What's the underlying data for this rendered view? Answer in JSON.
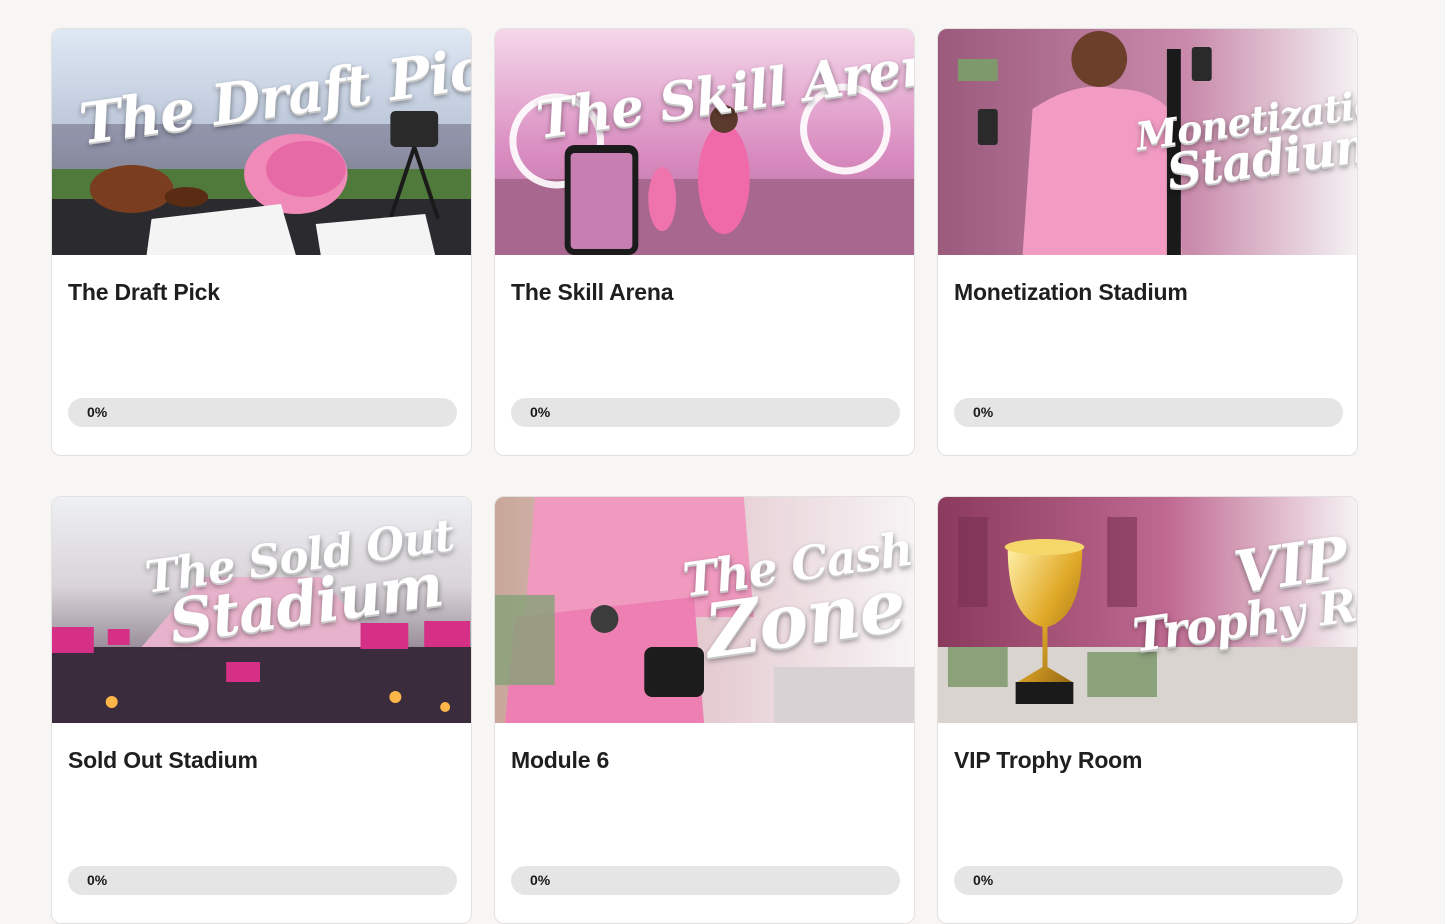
{
  "courses": [
    {
      "title": "The Draft Pick",
      "progress_label": "0%",
      "progress": 0,
      "thumbnail": {
        "line1": "The Draft Pick",
        "line2": "",
        "icon": "pink-helmet-stadium-image"
      }
    },
    {
      "title": "The Skill Arena",
      "progress_label": "0%",
      "progress": 0,
      "thumbnail": {
        "line1": "The Skill Arena",
        "line2": "",
        "icon": "pink-soccer-player-image"
      }
    },
    {
      "title": "Monetization Stadium",
      "progress_label": "0%",
      "progress": 0,
      "thumbnail": {
        "line1": "Monetization",
        "line2": "Stadium",
        "icon": "pink-jersey-media-image"
      }
    },
    {
      "title": "Sold Out Stadium",
      "progress_label": "0%",
      "progress": 0,
      "thumbnail": {
        "line1": "The Sold Out",
        "line2": "Stadium",
        "icon": "sold-out-crowd-image"
      }
    },
    {
      "title": "Module 6",
      "progress_label": "0%",
      "progress": 0,
      "thumbnail": {
        "line1": "The Cash",
        "line2": "Zone",
        "icon": "money-counter-image"
      }
    },
    {
      "title": "VIP Trophy Room",
      "progress_label": "0%",
      "progress": 0,
      "thumbnail": {
        "line1": "VIP",
        "line2": "Trophy Room",
        "icon": "gold-trophy-image"
      }
    }
  ],
  "colors": {
    "page_bg": "#f7f6f5",
    "card_bg": "#ffffff",
    "progress_track": "#e5e5e5",
    "accent_pink": "#e5579b"
  }
}
